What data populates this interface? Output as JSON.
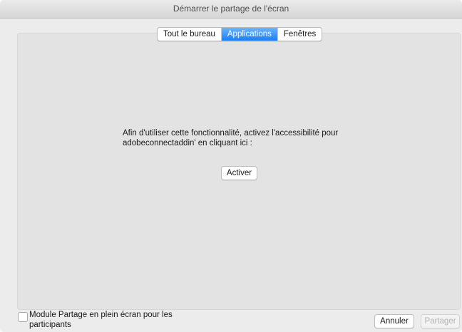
{
  "window": {
    "title": "Démarrer le partage de l'écran"
  },
  "tabs": [
    {
      "label": "Tout le bureau",
      "active": false
    },
    {
      "label": "Applications",
      "active": true
    },
    {
      "label": "Fenêtres",
      "active": false
    }
  ],
  "message": {
    "line1": "Afin d'utiliser cette fonctionnalité, activez l'accessibilité pour",
    "line2": "adobeconnectaddin' en cliquant ici :"
  },
  "buttons": {
    "activer": "Activer",
    "annuler": "Annuler",
    "partager": "Partager"
  },
  "fullscreen_option": {
    "line1": "Module Partage en plein écran pour les",
    "line2": "participants",
    "checked": false
  },
  "colors": {
    "accent": "#1c7ef2",
    "disabled_text": "#b3b3b3"
  }
}
